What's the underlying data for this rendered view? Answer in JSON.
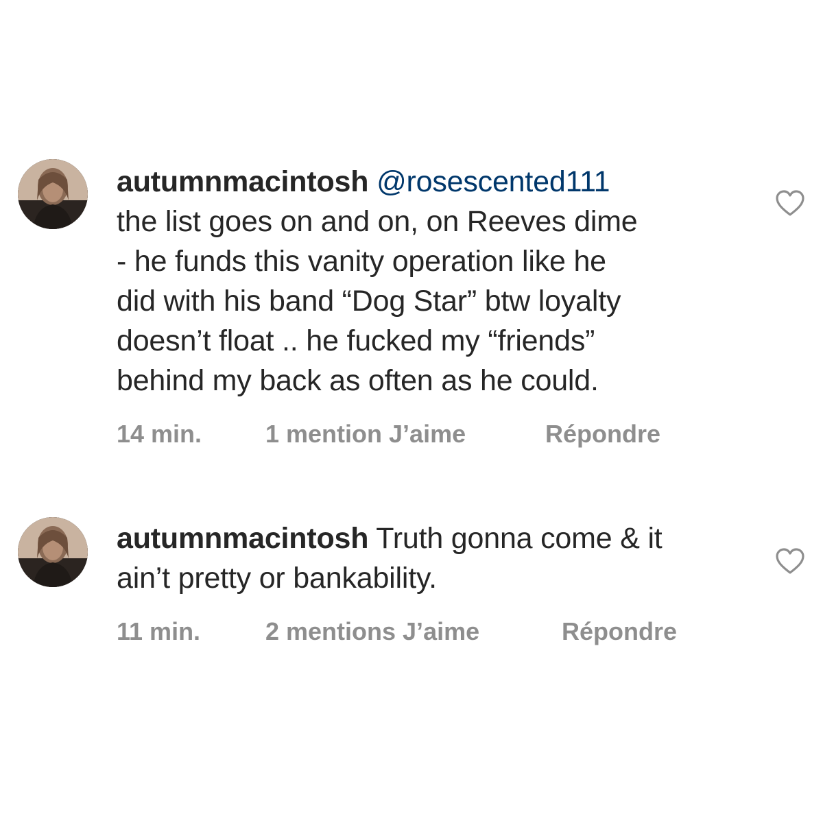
{
  "comments": [
    {
      "username": "autumnmacintosh",
      "mention": "@rosescented111",
      "text_lines": [
        "the list goes on and on, on Reeves dime",
        "- he funds this vanity operation like he",
        "did with his band “Dog Star” btw loyalty",
        "doesn’t float .. he fucked my “friends”",
        "behind my back as often as he could."
      ],
      "time": "14 min.",
      "likes": "1 mention J’aime",
      "reply": "Répondre",
      "like_icon": "heart-outline-icon"
    },
    {
      "username": "autumnmacintosh",
      "mention": "",
      "text_lines": [
        "Truth gonna come & it",
        "ain’t pretty or bankability."
      ],
      "time": "11 min.",
      "likes": "2 mentions J’aime",
      "reply": "Répondre",
      "like_icon": "heart-outline-icon"
    }
  ],
  "colors": {
    "text": "#262626",
    "mention": "#00376b",
    "meta": "#8e8e8e",
    "heart_stroke": "#8e8e8e"
  }
}
